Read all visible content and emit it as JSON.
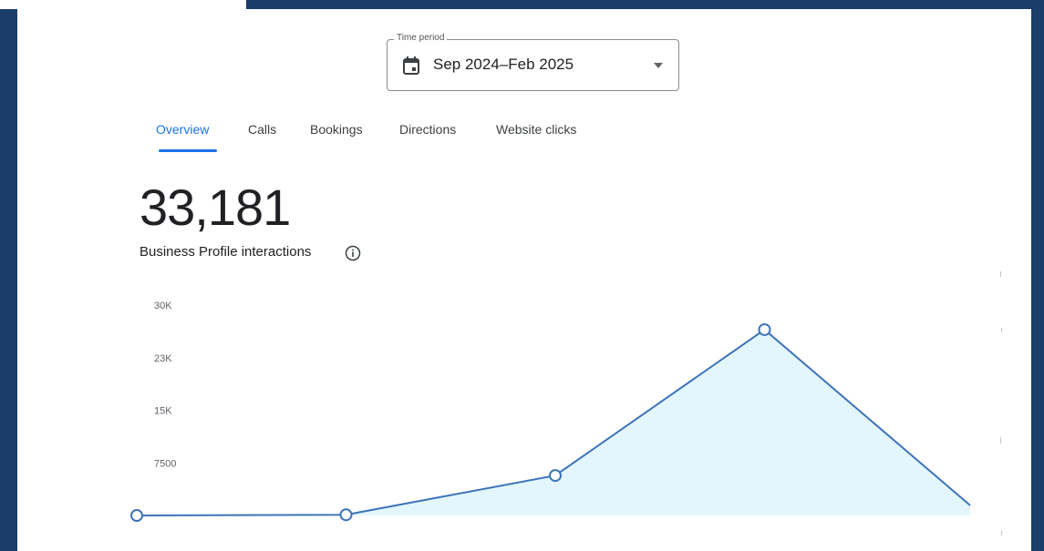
{
  "time_period": {
    "legend": "Time period",
    "value": "Sep 2024–Feb 2025"
  },
  "tabs": [
    {
      "label": "Overview",
      "active": true
    },
    {
      "label": "Calls",
      "active": false
    },
    {
      "label": "Bookings",
      "active": false
    },
    {
      "label": "Directions",
      "active": false
    },
    {
      "label": "Website clicks",
      "active": false
    }
  ],
  "metric": {
    "value": "33,181",
    "label": "Business Profile interactions"
  },
  "icons": {
    "calendar": "calendar-icon",
    "dropdown": "arrow-drop-down-icon",
    "info": "info-icon"
  },
  "colors": {
    "accent": "#1a73e8",
    "line": "#3d73b9",
    "area": "#e3f6fb",
    "frame": "#1a3d6a"
  },
  "chart_data": {
    "type": "area",
    "title": "",
    "xlabel": "",
    "ylabel": "",
    "y_ticks": [
      "30K",
      "23K",
      "15K",
      "7500"
    ],
    "y_tick_values": [
      30000,
      22500,
      15000,
      7500
    ],
    "ylim": [
      0,
      30000
    ],
    "grid": false,
    "series": [
      {
        "x": [
          0,
          1,
          2,
          3,
          4
        ],
        "values": [
          0,
          100,
          5700,
          26500,
          1000
        ]
      }
    ]
  }
}
